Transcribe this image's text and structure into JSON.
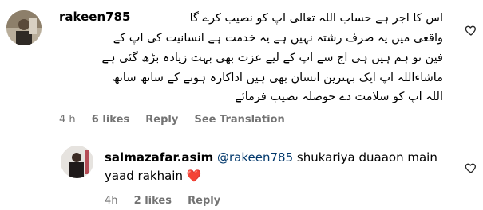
{
  "comments": [
    {
      "username": "rakeen785",
      "text_lines": [
        "اس کا اجر ہے حساب اللہ تعالی اپ کو نصیب کرے گا",
        "واقعی میں یہ صرف رشتہ نہیں ہے یہ خدمت ہے انسانیت کی اپ کے",
        "فین تو ہم ہیں ہی اج سے اپ کے لیے عزت بھی بہت زیادہ بڑھ گئی ہے",
        "ماشاءاللہ اپ ایک بہترین انسان بھی ہیں اداکارہ ہونے کے ساتھ ساتھ",
        "اللہ اپ کو سلامت دے حوصلہ نصیب فرمائے"
      ],
      "time": "4 h",
      "likes": "6 likes",
      "reply": "Reply",
      "see_translation": "See Translation"
    },
    {
      "username": "salmazafar.asim",
      "mention": "@rakeen785",
      "text_part1": " shukariya duaaon main",
      "text_line2": "yaad rakhain",
      "emoji": "❤️",
      "time": "4h",
      "likes": "2 likes",
      "reply": "Reply"
    }
  ],
  "icons": {
    "like": "heart-outline-icon"
  }
}
